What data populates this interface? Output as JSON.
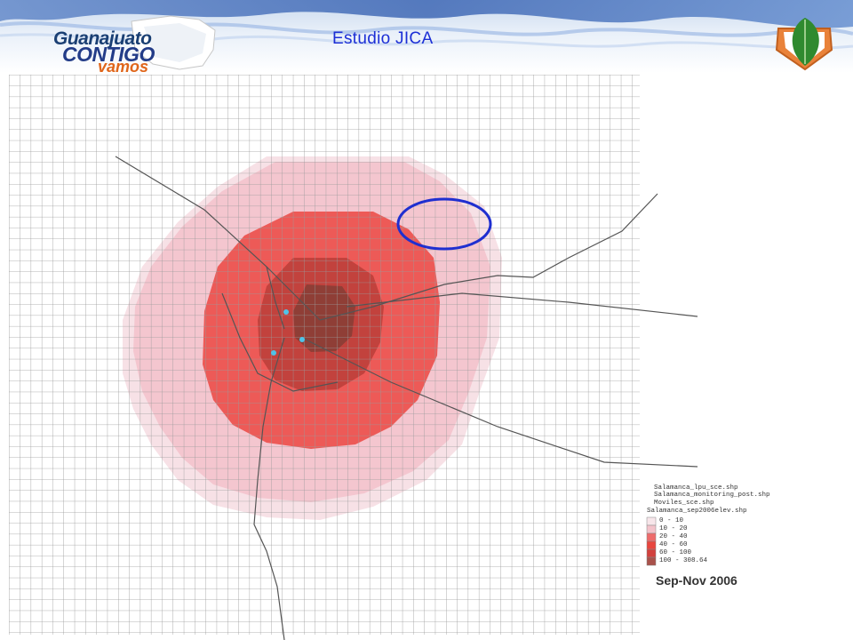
{
  "slide": {
    "title": "Estudio JICA"
  },
  "logo": {
    "line1": "Guanajuato",
    "line2": "CONTIGO",
    "line3": "vamos"
  },
  "map": {
    "date": "Sep-Nov 2006",
    "legend_layers": [
      "Salamanca_lpu_sce.shp",
      "Salamanca_monitoring_post.shp",
      "Moviles_sce.shp",
      "Salamanca_sep2006elev.shp"
    ],
    "legend_classes": [
      {
        "label": "0 - 10",
        "color": "#f7e6ea"
      },
      {
        "label": "10 - 20",
        "color": "#f3c3cb"
      },
      {
        "label": "20 - 40",
        "color": "#ee6b6b"
      },
      {
        "label": "40 - 60",
        "color": "#e8463f"
      },
      {
        "label": "60 - 100",
        "color": "#d2413d"
      },
      {
        "label": "100 - 308.64",
        "color": "#a9524b"
      }
    ],
    "colors": {
      "zone_outer": "#f7e1e6",
      "zone_light": "#f4c6cf",
      "zone_medium": "#ed5a57",
      "zone_dark": "#c2423d",
      "zone_core": "#8f3e36",
      "monitoring_post": "#4fc3e8",
      "highlight_ellipse": "#1f2fd0",
      "grid": "#9a9a9a"
    }
  }
}
